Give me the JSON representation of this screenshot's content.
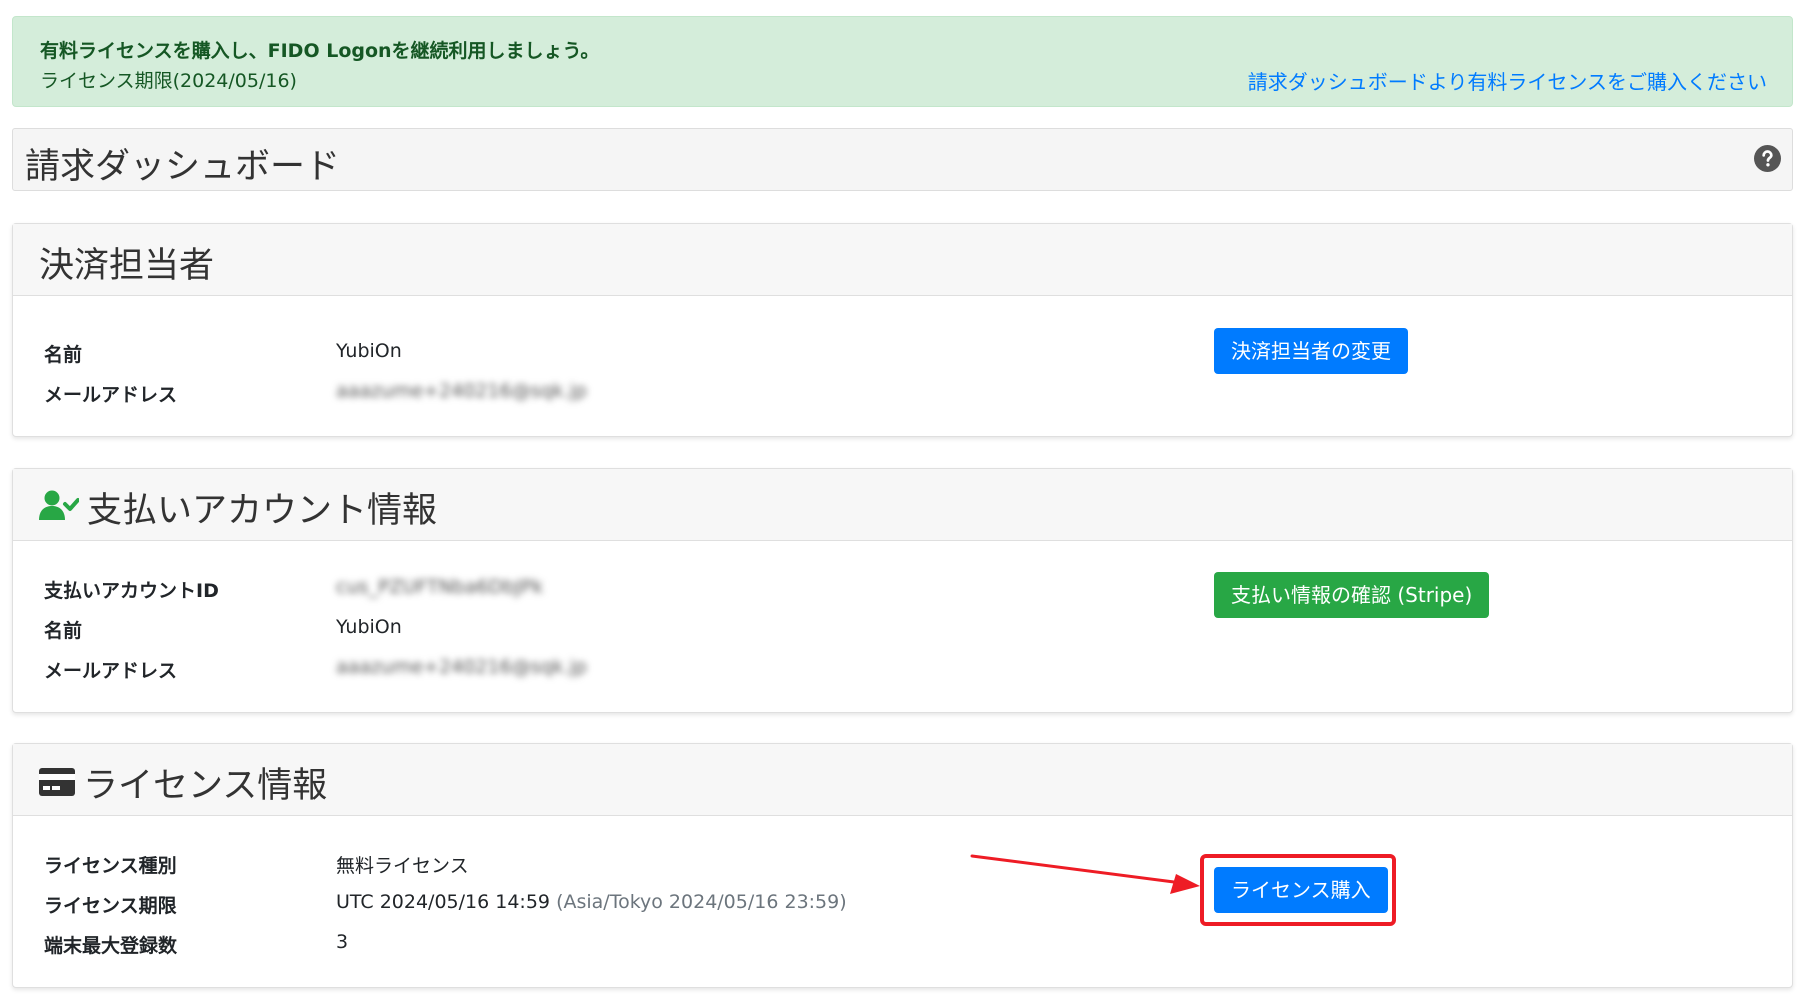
{
  "alert": {
    "title": "有料ライセンスを購入し、FIDO Logonを継続利用しましょう。",
    "expiry": "ライセンス期限(2024/05/16)",
    "link": "請求ダッシュボードより有料ライセンスをご購入ください"
  },
  "page": {
    "title": "請求ダッシュボード",
    "help_icon": "question-circle-icon"
  },
  "payer": {
    "title": "決済担当者",
    "fields": [
      {
        "label": "名前",
        "value": "YubiOn"
      },
      {
        "label": "メールアドレス",
        "value": "aaazume+240216@sqk.jp"
      }
    ],
    "button": "決済担当者の変更"
  },
  "account": {
    "title": "支払いアカウント情報",
    "icon": "user-check-icon",
    "fields": [
      {
        "label": "支払いアカウントID",
        "value": "cus_PZUFTNba6DbJPk"
      },
      {
        "label": "名前",
        "value": "YubiOn"
      },
      {
        "label": "メールアドレス",
        "value": "aaazume+240216@sqk.jp"
      }
    ],
    "button": "支払い情報の確認 (Stripe)"
  },
  "license": {
    "title": "ライセンス情報",
    "icon": "credit-card-icon",
    "fields": [
      {
        "label": "ライセンス種別",
        "value": "無料ライセンス"
      },
      {
        "label": "ライセンス期限",
        "value": "UTC 2024/05/16 14:59",
        "secondary": "(Asia/Tokyo 2024/05/16 23:59)"
      },
      {
        "label": "端末最大登録数",
        "value": "3"
      }
    ],
    "button": "ライセンス購入"
  },
  "colors": {
    "primary": "#007bff",
    "success": "#28a745",
    "alert_bg": "#d4edda",
    "alert_text": "#155724",
    "annotation": "#ee1c25"
  }
}
